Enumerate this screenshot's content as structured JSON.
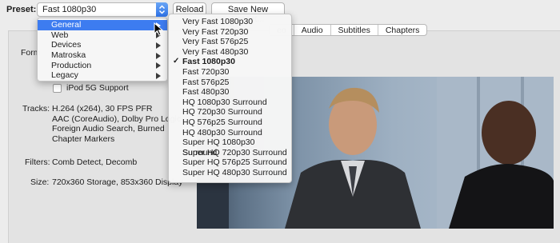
{
  "toolbar": {
    "preset_label": "Preset:",
    "preset_value": "Fast 1080p30",
    "reload_label": "Reload",
    "save_label": "Save New Preset..."
  },
  "tabs": [
    "eo",
    "Audio",
    "Subtitles",
    "Chapters"
  ],
  "summary": {
    "format_label": "Form",
    "ipod_label": "iPod 5G Support",
    "ipod_checked": false,
    "tracks_label": "Tracks:",
    "tracks_lines": [
      "H.264 (x264), 30 FPS PFR",
      "AAC (CoreAudio), Dolby Pro Logic",
      "Foreign Audio Search, Burned",
      "Chapter Markers"
    ],
    "filters_label": "Filters:",
    "filters_value": "Comb Detect, Decomb",
    "size_label": "Size:",
    "size_value": "720x360 Storage, 853x360 Display"
  },
  "preset_menu": {
    "categories": [
      {
        "label": "General",
        "active": true
      },
      {
        "label": "Web",
        "active": false
      },
      {
        "label": "Devices",
        "active": false
      },
      {
        "label": "Matroska",
        "active": false
      },
      {
        "label": "Production",
        "active": false
      },
      {
        "label": "Legacy",
        "active": false
      }
    ],
    "presets": [
      {
        "label": "Very Fast 1080p30",
        "selected": false
      },
      {
        "label": "Very Fast 720p30",
        "selected": false
      },
      {
        "label": "Very Fast 576p25",
        "selected": false
      },
      {
        "label": "Very Fast 480p30",
        "selected": false
      },
      {
        "label": "Fast 1080p30",
        "selected": true
      },
      {
        "label": "Fast 720p30",
        "selected": false
      },
      {
        "label": "Fast 576p25",
        "selected": false
      },
      {
        "label": "Fast 480p30",
        "selected": false
      },
      {
        "label": "HQ 1080p30 Surround",
        "selected": false
      },
      {
        "label": "HQ 720p30 Surround",
        "selected": false
      },
      {
        "label": "HQ 576p25 Surround",
        "selected": false
      },
      {
        "label": "HQ 480p30 Surround",
        "selected": false
      },
      {
        "label": "Super HQ 1080p30 Surround",
        "selected": false
      },
      {
        "label": "Super HQ 720p30 Surround",
        "selected": false
      },
      {
        "label": "Super HQ 576p25 Surround",
        "selected": false
      },
      {
        "label": "Super HQ 480p30 Surround",
        "selected": false
      }
    ],
    "check_glyph": "✓"
  },
  "colors": {
    "menu_highlight": "#3d7cf0",
    "window_bg": "#ececec"
  }
}
